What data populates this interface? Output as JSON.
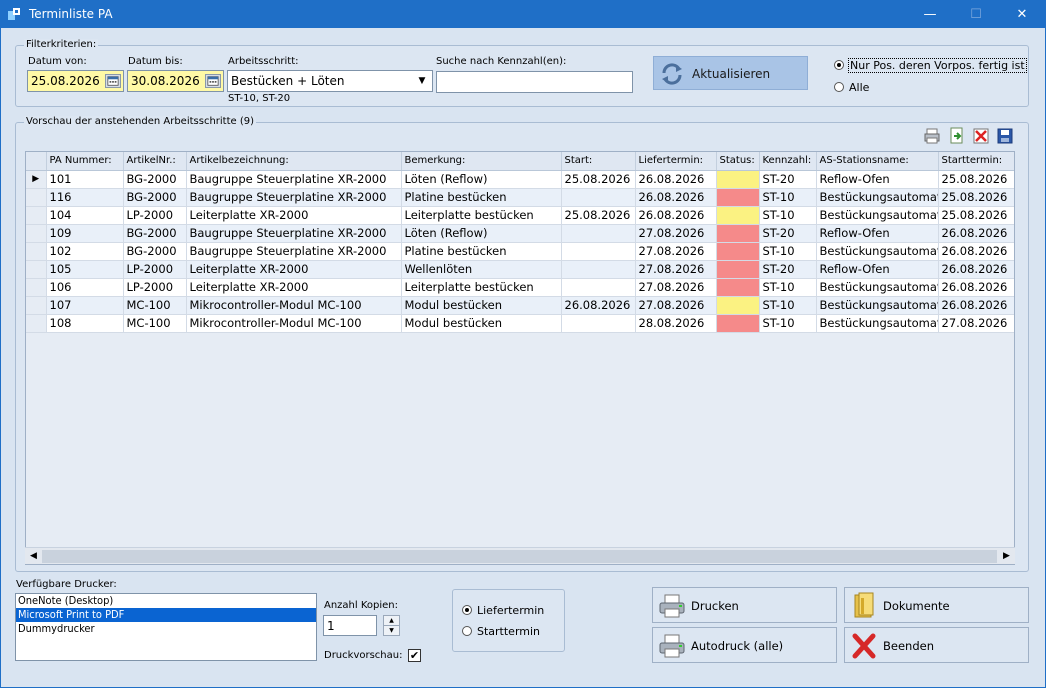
{
  "window": {
    "title": "Terminliste PA",
    "minimize": "—",
    "maximize": "☐",
    "close": "✕"
  },
  "filter": {
    "group_label": "Filterkriterien:",
    "date_from_label": "Datum von:",
    "date_from": "25.08.2026",
    "date_to_label": "Datum bis:",
    "date_to": "30.08.2026",
    "step_label": "Arbeitsschritt:",
    "step_value": "Bestücken + Löten",
    "step_hint": "ST-10, ST-20",
    "search_label": "Suche nach Kennzahl(en):",
    "search_value": "",
    "refresh_label": "Aktualisieren",
    "radio_only_prev": "Nur Pos. deren Vorpos. fertig ist",
    "radio_all": "Alle"
  },
  "preview": {
    "group_label": "Vorschau der anstehenden Arbeitsschritte (9)",
    "columns": [
      "",
      "PA Nummer:",
      "ArtikelNr.:",
      "Artikelbezeichnung:",
      "Bemerkung:",
      "Start:",
      "Liefertermin:",
      "Status:",
      "Kennzahl:",
      "AS-Stationsname:",
      "Starttermin:"
    ],
    "rows": [
      {
        "sel": "▶",
        "pa": "101",
        "art": "BG-2000",
        "bez": "Baugruppe Steuerplatine XR-2000",
        "bem": "Löten (Reflow)",
        "start": "25.08.2026",
        "liefer": "26.08.2026",
        "status": "yellow",
        "kz": "ST-20",
        "station": "Reflow-Ofen",
        "starttermin": "25.08.2026"
      },
      {
        "sel": "",
        "pa": "116",
        "art": "BG-2000",
        "bez": "Baugruppe Steuerplatine XR-2000",
        "bem": "Platine bestücken",
        "start": "",
        "liefer": "26.08.2026",
        "status": "red",
        "kz": "ST-10",
        "station": "Bestückungsautomat",
        "starttermin": "25.08.2026"
      },
      {
        "sel": "",
        "pa": "104",
        "art": "LP-2000",
        "bez": "Leiterplatte XR-2000",
        "bem": "Leiterplatte bestücken",
        "start": "25.08.2026",
        "liefer": "26.08.2026",
        "status": "yellow",
        "kz": "ST-10",
        "station": "Bestückungsautomat",
        "starttermin": "25.08.2026"
      },
      {
        "sel": "",
        "pa": "109",
        "art": "BG-2000",
        "bez": "Baugruppe Steuerplatine XR-2000",
        "bem": "Löten (Reflow)",
        "start": "",
        "liefer": "27.08.2026",
        "status": "red",
        "kz": "ST-20",
        "station": "Reflow-Ofen",
        "starttermin": "26.08.2026"
      },
      {
        "sel": "",
        "pa": "102",
        "art": "BG-2000",
        "bez": "Baugruppe Steuerplatine XR-2000",
        "bem": "Platine bestücken",
        "start": "",
        "liefer": "27.08.2026",
        "status": "red",
        "kz": "ST-10",
        "station": "Bestückungsautomat",
        "starttermin": "26.08.2026"
      },
      {
        "sel": "",
        "pa": "105",
        "art": "LP-2000",
        "bez": "Leiterplatte XR-2000",
        "bem": "Wellenlöten",
        "start": "",
        "liefer": "27.08.2026",
        "status": "red",
        "kz": "ST-20",
        "station": "Reflow-Ofen",
        "starttermin": "26.08.2026"
      },
      {
        "sel": "",
        "pa": "106",
        "art": "LP-2000",
        "bez": "Leiterplatte XR-2000",
        "bem": "Leiterplatte bestücken",
        "start": "",
        "liefer": "27.08.2026",
        "status": "red",
        "kz": "ST-10",
        "station": "Bestückungsautomat",
        "starttermin": "26.08.2026"
      },
      {
        "sel": "",
        "pa": "107",
        "art": "MC-100",
        "bez": "Mikrocontroller-Modul MC-100",
        "bem": "Modul bestücken",
        "start": "26.08.2026",
        "liefer": "27.08.2026",
        "status": "yellow",
        "kz": "ST-10",
        "station": "Bestückungsautomat",
        "starttermin": "26.08.2026"
      },
      {
        "sel": "",
        "pa": "108",
        "art": "MC-100",
        "bez": "Mikrocontroller-Modul MC-100",
        "bem": "Modul bestücken",
        "start": "",
        "liefer": "28.08.2026",
        "status": "red",
        "kz": "ST-10",
        "station": "Bestückungsautomat",
        "starttermin": "27.08.2026"
      }
    ],
    "status_colors": {
      "yellow": "#fbf282",
      "red": "#f58a8a"
    },
    "toolbar_icons": [
      "printer-icon",
      "export-icon",
      "delete-icon",
      "save-icon"
    ]
  },
  "print": {
    "printers_label": "Verfügbare Drucker:",
    "printers": [
      "OneNote (Desktop)",
      "Microsoft Print to PDF",
      "Dummydrucker"
    ],
    "selected_printer": "Microsoft Print to PDF",
    "copies_label": "Anzahl Kopien:",
    "copies_value": "1",
    "preview_label": "Druckvorschau:",
    "preview_checked": "✔",
    "sort_liefer": "Liefertermin",
    "sort_start": "Starttermin"
  },
  "buttons": {
    "print": "Drucken",
    "documents": "Dokumente",
    "autoprint": "Autodruck (alle)",
    "exit": "Beenden"
  }
}
